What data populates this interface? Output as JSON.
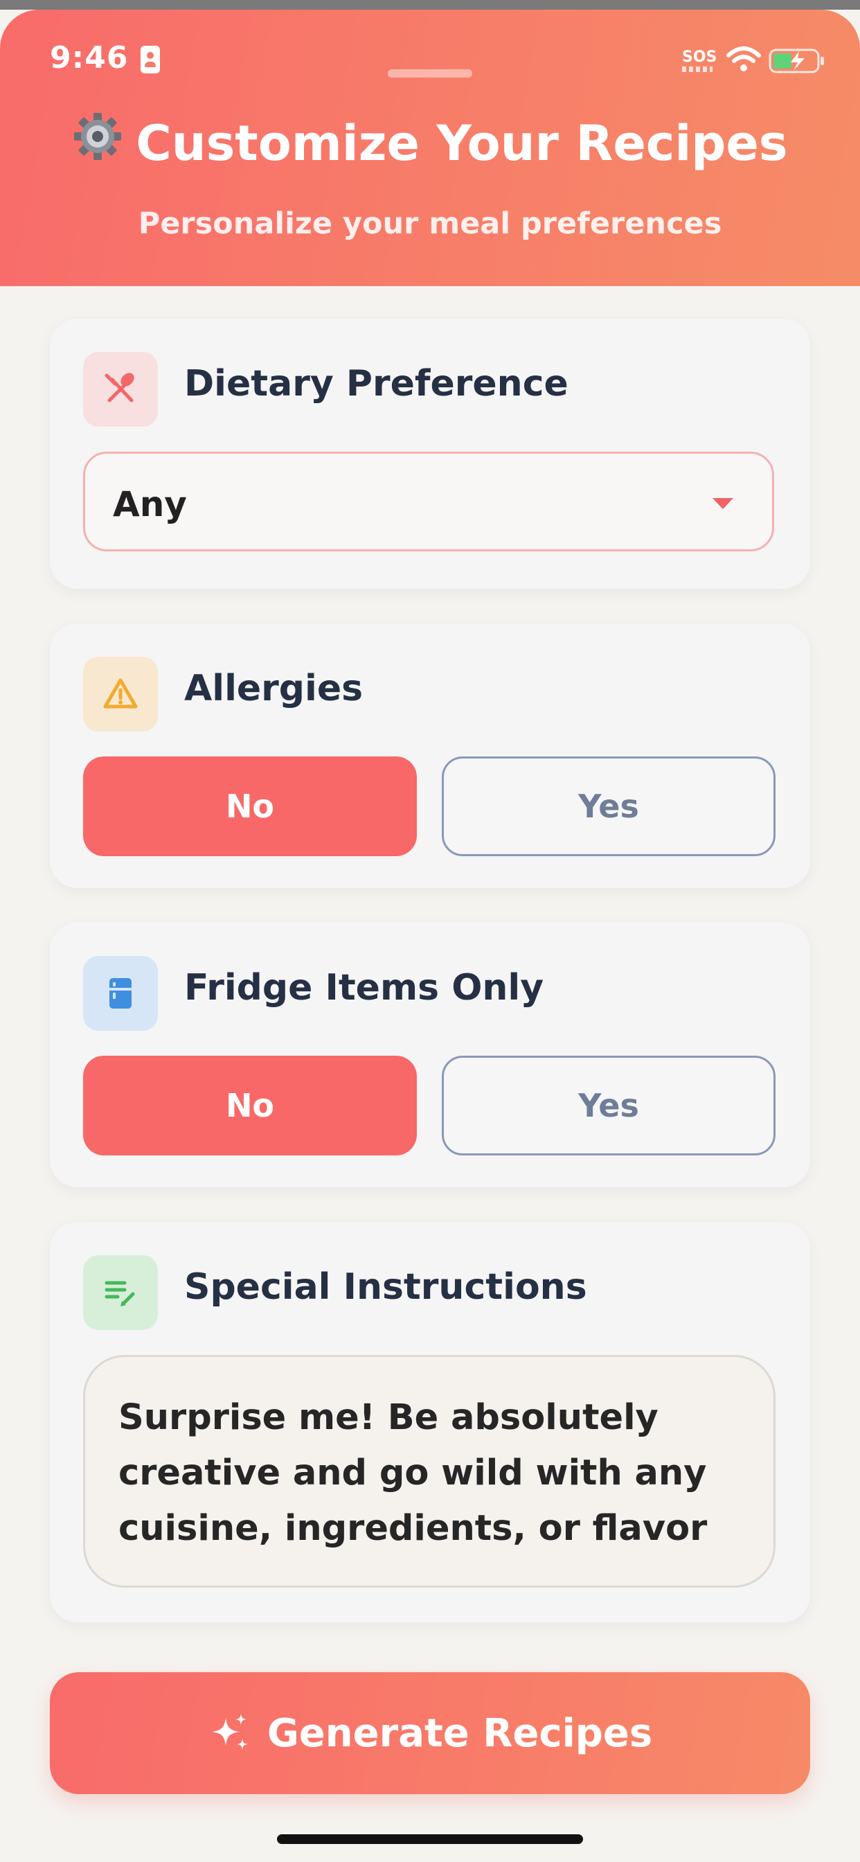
{
  "status_bar": {
    "time": "9:46",
    "sos": "SOS"
  },
  "header": {
    "title": "Customize Your Recipes",
    "subtitle": "Personalize your meal preferences"
  },
  "dietary": {
    "title": "Dietary Preference",
    "selected": "Any",
    "icon": "utensils-icon"
  },
  "allergies": {
    "title": "Allergies",
    "options": [
      "No",
      "Yes"
    ],
    "selected": "No",
    "icon": "warning-icon"
  },
  "fridge": {
    "title": "Fridge Items Only",
    "options": [
      "No",
      "Yes"
    ],
    "selected": "No",
    "icon": "fridge-icon"
  },
  "instructions": {
    "title": "Special Instructions",
    "value": "Surprise me! Be absolutely creative and go wild with any cuisine, ingredients, or flavor",
    "icon": "edit-note-icon"
  },
  "generate_button": {
    "label": "Generate Recipes",
    "icon": "sparkles-icon"
  },
  "colors": {
    "accent": "#f86868",
    "accent_gradient_end": "#f68c67",
    "text_dark": "#263044",
    "background": "#f5f3f0"
  }
}
